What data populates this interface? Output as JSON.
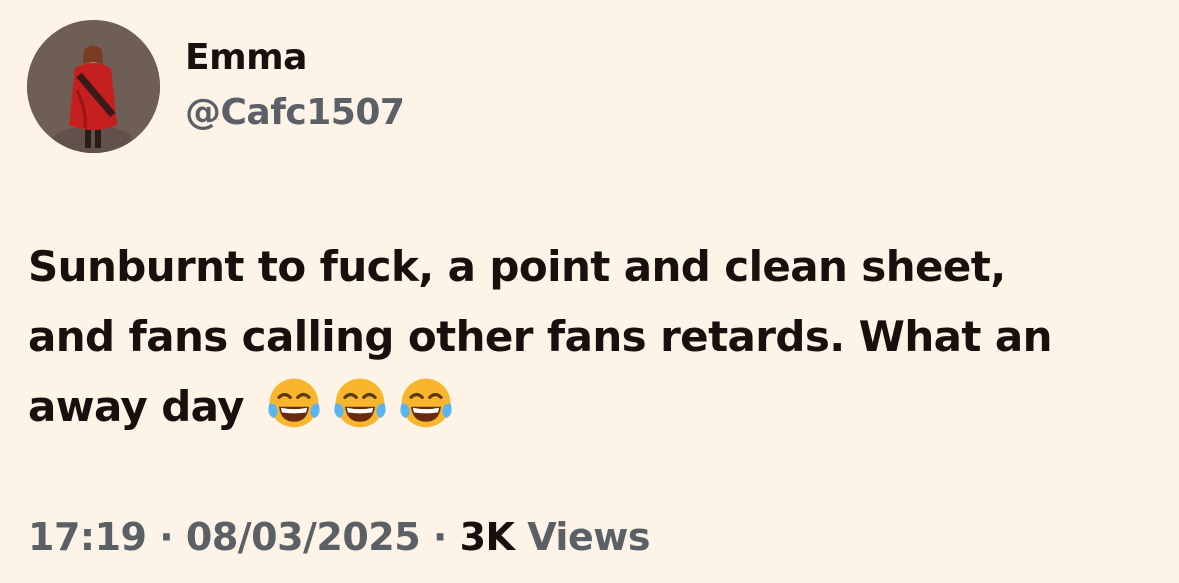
{
  "author": {
    "display_name": "Emma",
    "handle": "@Cafc1507",
    "avatar_icon": "profile-photo-red-jersey"
  },
  "tweet": {
    "lines": [
      "Sunburnt to fuck, a point and clean sheet,",
      "and fans calling other fans retards. What an",
      "away day"
    ],
    "emojis": [
      "face-with-tears-of-joy",
      "face-with-tears-of-joy",
      "face-with-tears-of-joy"
    ]
  },
  "meta": {
    "time": "17:19",
    "separator": "·",
    "date": "08/03/2025",
    "views_count": "3K",
    "views_label": "Views"
  },
  "colors": {
    "background": "#fdf3e7",
    "primary_text": "#1a0f0c",
    "secondary_text": "#5a6066"
  }
}
